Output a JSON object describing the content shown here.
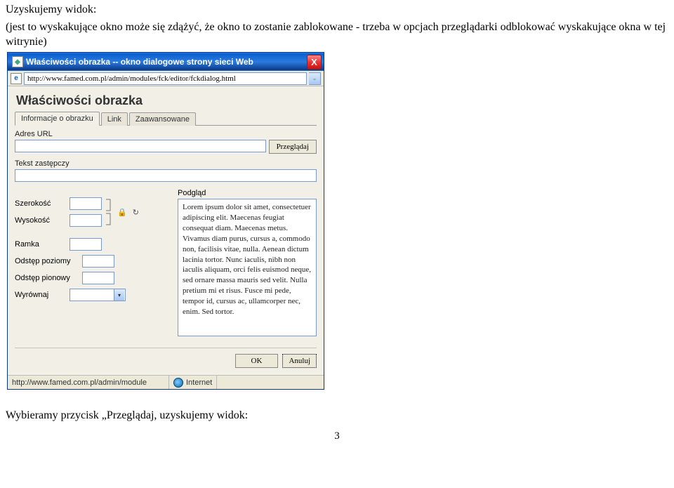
{
  "doc": {
    "line1": "Uzyskujemy widok:",
    "line2": "(jest to wyskakujące okno może się zdążyć, że okno to zostanie zablokowane - trzeba w opcjach przeglądarki odblokować wyskakujące okna w tej witrynie)",
    "bottom": "Wybieramy przycisk „Przeglądaj, uzyskujemy widok:",
    "page_number": "3"
  },
  "window": {
    "title": "Właściwości obrazka -- okno dialogowe strony sieci Web",
    "title_icon_glyph": "◆",
    "close_glyph": "X",
    "address": "http://www.famed.com.pl/admin/modules/fck/editor/fckdialog.html",
    "ie_glyph": "e",
    "dropdown_glyph": "⌄"
  },
  "dialog": {
    "heading": "Właściwości obrazka",
    "tabs": {
      "info": "Informacje o obrazku",
      "link": "Link",
      "advanced": "Zaawansowane"
    },
    "labels": {
      "url": "Adres URL",
      "browse": "Przeglądaj",
      "alt": "Tekst zastępczy",
      "width": "Szerokość",
      "height": "Wysokość",
      "lock": "🔒",
      "reset": "↻",
      "border": "Ramka",
      "hspace": "Odstęp poziomy",
      "vspace": "Odstęp pionowy",
      "align": "Wyrównaj",
      "preview": "Podgląd",
      "ok": "OK",
      "cancel": "Anuluj"
    },
    "values": {
      "url": "",
      "alt": "",
      "width": "",
      "height": "",
      "border": "",
      "hspace": "",
      "vspace": "",
      "align": ""
    },
    "preview_text": "Lorem ipsum dolor sit amet, consectetuer adipiscing elit. Maecenas feugiat consequat diam. Maecenas metus. Vivamus diam purus, cursus a, commodo non, facilisis vitae, nulla. Aenean dictum lacinia tortor. Nunc iaculis, nibh non iaculis aliquam, orci felis euismod neque, sed ornare massa mauris sed velit. Nulla pretium mi et risus. Fusce mi pede, tempor id, cursus ac, ullamcorper nec, enim. Sed tortor."
  },
  "status": {
    "left": "http://www.famed.com.pl/admin/module",
    "zone": "Internet"
  }
}
